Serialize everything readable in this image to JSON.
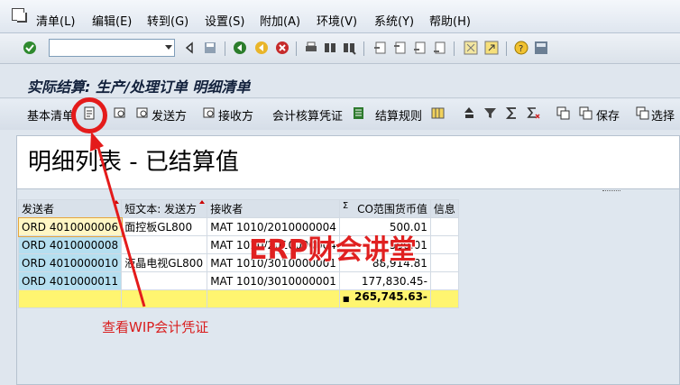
{
  "menu": {
    "items": [
      "清单(L)",
      "编辑(E)",
      "转到(G)",
      "设置(S)",
      "附加(A)",
      "环境(V)",
      "系统(Y)",
      "帮助(H)"
    ]
  },
  "toolbar": {
    "command_field_value": "",
    "icons": [
      "enter-icon",
      "back-icon",
      "exit-icon",
      "cancel-icon",
      "print-icon",
      "find-icon",
      "find-next-icon",
      "first-page-icon",
      "prev-page-icon",
      "next-page-icon",
      "last-page-icon",
      "new-session-icon",
      "shortcut-icon",
      "help-icon",
      "layout-icon"
    ]
  },
  "title": "实际结算: 生产/处理订单 明细清单",
  "app_toolbar": {
    "basic_list": "基本清单",
    "sender": "发送方",
    "receiver": "接收方",
    "accounting_document": "会计核算凭证",
    "settlement_rule": "结算规则",
    "save": "保存",
    "select": "选择"
  },
  "heading": "明细列表 - 已结算值",
  "table": {
    "headers": [
      "发送者",
      "短文本: 发送方",
      "接收者",
      "CO范围货币值",
      "信息"
    ],
    "sum_symbol": "Σ",
    "rows": [
      {
        "sender": "ORD 4010000006",
        "text": "面控板GL800",
        "receiver": "MAT 1010/2010000004",
        "value": "500.01"
      },
      {
        "sender": "ORD 4010000008",
        "text": "",
        "receiver": "MAT 1010/2010000004",
        "value": "500.01"
      },
      {
        "sender": "ORD 4010000010",
        "text": "液晶电视GL800",
        "receiver": "MAT 1010/3010000001",
        "value": "88,914.81"
      },
      {
        "sender": "ORD 4010000011",
        "text": "",
        "receiver": "MAT 1010/3010000001",
        "value": "177,830.45-"
      }
    ],
    "total_marker": "■",
    "total": "265,745.63-"
  },
  "annotations": {
    "watermark": "ERP财会讲堂",
    "note": "查看WIP会计凭证"
  },
  "colors": {
    "key_cell": "#b5dff0",
    "selected_cell": "#fff6c4",
    "total_row": "#fff570",
    "annotation_red": "#e02020"
  }
}
